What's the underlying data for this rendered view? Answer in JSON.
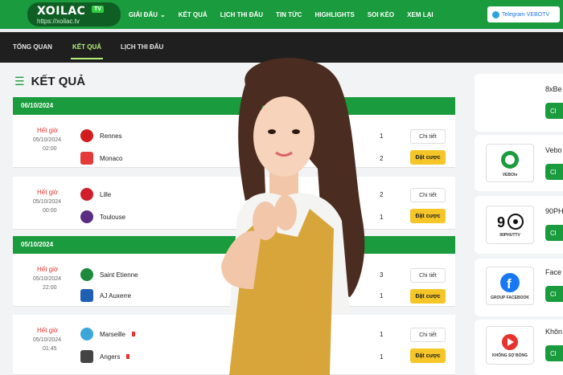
{
  "header": {
    "logo_name": "XOILAC",
    "logo_badge": "TV",
    "logo_url": "https://xoilac.tv",
    "nav": [
      {
        "label": "GIẢI ĐẤU",
        "has_dropdown": true
      },
      {
        "label": "KẾT QUẢ"
      },
      {
        "label": "LỊCH THI ĐẤU"
      },
      {
        "label": "TIN TỨC"
      },
      {
        "label": "HIGHLIGHTS"
      },
      {
        "label": "SOI KÈO"
      },
      {
        "label": "XEM LẠI"
      }
    ],
    "telegram_label": "Telegram VEBOTV"
  },
  "subnav": {
    "items": [
      "TỔNG QUAN",
      "KẾT QUẢ",
      "LỊCH THI ĐẤU"
    ],
    "active": "KẾT QUẢ"
  },
  "main": {
    "title": "KẾT QUẢ",
    "groups": [
      {
        "date": "06/10/2024",
        "matches": [
          {
            "status": "Hết giờ",
            "date": "05/10/2024",
            "time": "02:00",
            "home": "Rennes",
            "away": "Monaco",
            "home_score": "1",
            "away_score": "2"
          },
          {
            "status": "Hết giờ",
            "date": "05/10/2024",
            "time": "00:00",
            "home": "Lille",
            "away": "Toulouse",
            "home_score": "2",
            "away_score": "1"
          }
        ]
      },
      {
        "date": "05/10/2024",
        "matches": [
          {
            "status": "Hết giờ",
            "date": "05/10/2024",
            "time": "22:00",
            "home": "Saint Etienne",
            "away": "AJ Auxerre",
            "home_score": "3",
            "away_score": "1"
          },
          {
            "status": "Hết giờ",
            "date": "05/10/2024",
            "time": "01:45",
            "home": "Marseille",
            "away": "Angers",
            "home_score": "1",
            "away_score": "1"
          }
        ]
      }
    ],
    "detail_label": "Chi tiết",
    "bet_label": "Đặt cược"
  },
  "sidebar": {
    "cards": [
      {
        "label": "8xBe",
        "logo": ""
      },
      {
        "label": "Vebo",
        "logo": "VEBOtv"
      },
      {
        "label": "90PH",
        "logo": "90PHUTTV"
      },
      {
        "label": "Face",
        "logo": "GROUP FACEBOOK"
      },
      {
        "label": "Khôn",
        "logo": "KHÔNG SỢ BÓNG"
      }
    ],
    "button_label": "Cl"
  },
  "colors": {
    "primary_green": "#1a9b3d",
    "dark_bar": "#1f1f1f",
    "status_red": "#e8322d",
    "bet_yellow": "#f6c628",
    "active_tab": "#b6f27a"
  }
}
